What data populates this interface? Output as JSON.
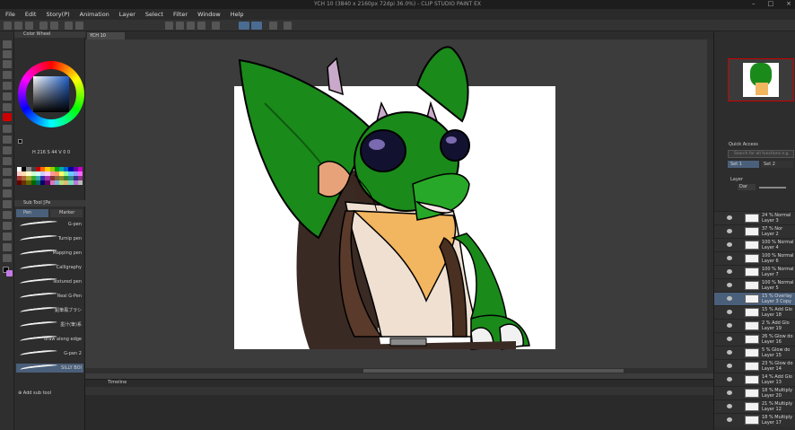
{
  "window": {
    "title": "YCH 10 (3840 x 2160px 72dpi 36.0%) - CLIP STUDIO PAINT EX",
    "controls": [
      "–",
      "□",
      "×"
    ]
  },
  "menu": [
    "File",
    "Edit",
    "Story(P)",
    "Animation",
    "Layer",
    "Select",
    "Filter",
    "Window",
    "Help"
  ],
  "document_tab": "YCH 10",
  "color_wheel": {
    "label": "Color Wheel",
    "readout": "H 216  S 44  V 0  0"
  },
  "subtool": {
    "group_label": "Sub Tool [Pe",
    "tabs": [
      "Pen",
      "Marker"
    ],
    "brushes": [
      "G-pen",
      "Turnip pen",
      "Mapping pen",
      "Calligraphy",
      "Textured pen",
      "Real G-Pen",
      "鉛筆風ブラシ",
      "墨汁(筆)系",
      "draw along edge",
      "G-pen 2",
      "SILLY BOI"
    ],
    "add_label": "Add sub tool"
  },
  "timeline": {
    "label": "Timeline"
  },
  "right_panel": {
    "quick_access": "Quick Access",
    "search_placeholder": "Search for all functions e.g.",
    "sets": [
      "Set 1",
      "Set 2"
    ],
    "layer_label": "Layer",
    "blend_mode": "Dar",
    "layers": [
      {
        "pct": "24 %",
        "mode": "Normal",
        "name": "Layer 3",
        "selected": false
      },
      {
        "pct": "37 %",
        "mode": "Nor",
        "name": "Layer 2",
        "selected": false
      },
      {
        "pct": "100 %",
        "mode": "Normal",
        "name": "Layer 4",
        "selected": false
      },
      {
        "pct": "100 %",
        "mode": "Normal",
        "name": "Layer 6",
        "selected": false
      },
      {
        "pct": "100 %",
        "mode": "Normal",
        "name": "Layer 7",
        "selected": false
      },
      {
        "pct": "100 %",
        "mode": "Normal",
        "name": "Layer 5",
        "selected": false
      },
      {
        "pct": "15 %",
        "mode": "Overlay",
        "name": "Layer 3 Copy",
        "selected": true
      },
      {
        "pct": "15 %",
        "mode": "Add Glo",
        "name": "Layer 18",
        "selected": false
      },
      {
        "pct": "2 %",
        "mode": "Add Glo",
        "name": "Layer 19",
        "selected": false
      },
      {
        "pct": "26 %",
        "mode": "Glow do",
        "name": "Layer 16",
        "selected": false
      },
      {
        "pct": "5 %",
        "mode": "Glow do",
        "name": "Layer 15",
        "selected": false
      },
      {
        "pct": "23 %",
        "mode": "Glow do",
        "name": "Layer 14",
        "selected": false
      },
      {
        "pct": "14 %",
        "mode": "Add Glo",
        "name": "Layer 13",
        "selected": false
      },
      {
        "pct": "18 %",
        "mode": "Multiply",
        "name": "Layer 20",
        "selected": false
      },
      {
        "pct": "21 %",
        "mode": "Multiply",
        "name": "Layer 12",
        "selected": false
      },
      {
        "pct": "18 %",
        "mode": "Multiply",
        "name": "Layer 17",
        "selected": false
      }
    ]
  },
  "colors": {
    "main": "#cc0000",
    "sub": "#ffffff",
    "accent": "#4a5f7a",
    "character_green": "#1a8a1a"
  }
}
